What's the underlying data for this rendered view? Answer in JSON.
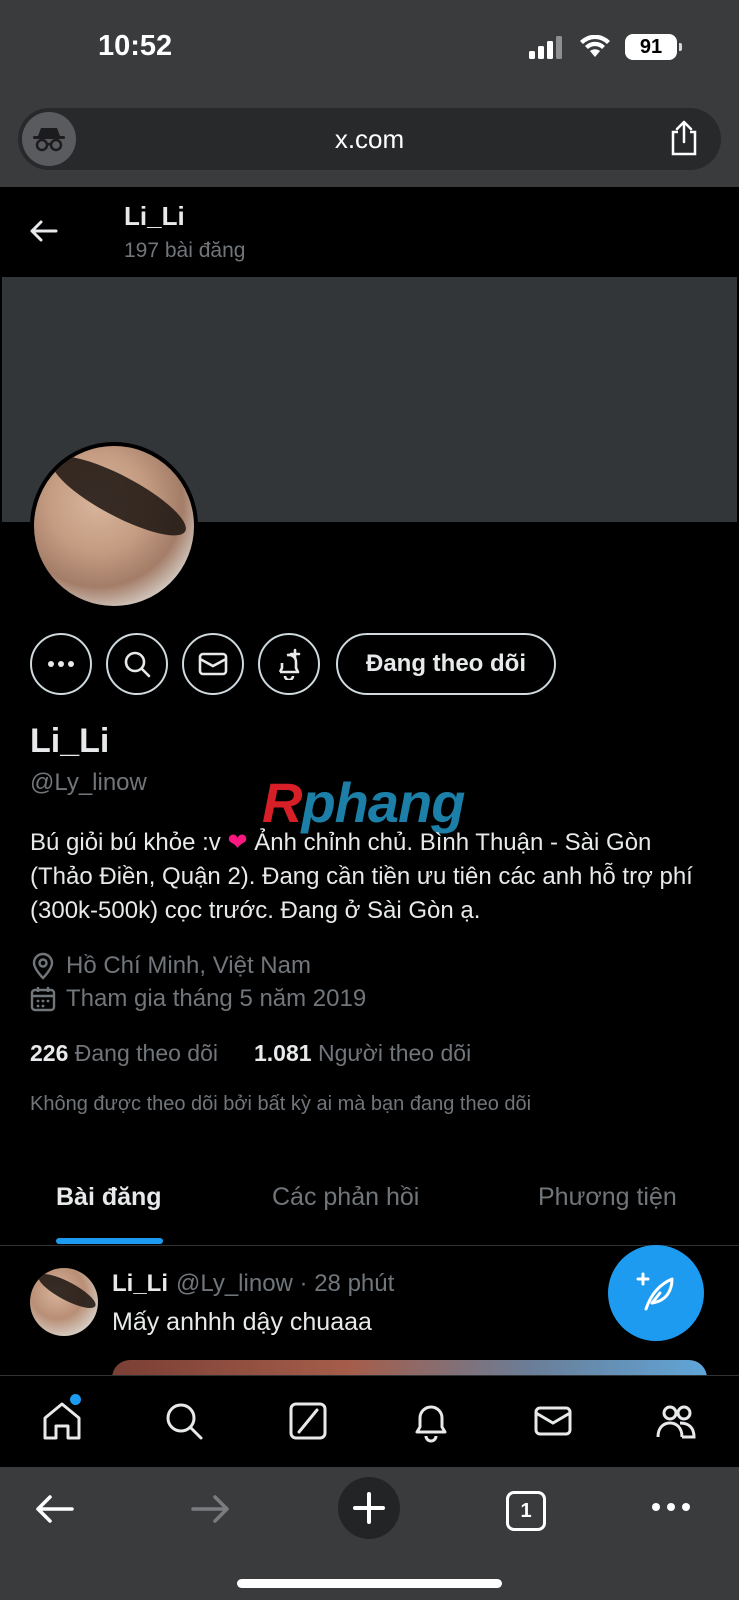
{
  "status": {
    "time": "10:52",
    "battery": "91"
  },
  "browser": {
    "url": "x.com",
    "tab_count": "1"
  },
  "header": {
    "name": "Li_Li",
    "post_count": "197 bài đăng"
  },
  "profile": {
    "name": "Li_Li",
    "handle": "@Ly_linow",
    "follow_button": "Đang theo dõi",
    "bio_before": "Bú giỏi bú khỏe :v ",
    "bio_heart": "❤",
    "bio_after": " Ảnh chỉnh chủ. Bình Thuận - Sài Gòn (Thảo Điền, Quận 2). Đang cần tiền ưu tiên các anh hỗ trợ phí (300k-500k) cọc trước. Đang ở Sài Gòn ạ.",
    "location": "Hồ Chí Minh, Việt Nam",
    "joined": "Tham gia tháng 5 năm 2019",
    "following_count": "226",
    "following_label": "Đang theo dõi",
    "followers_count": "1.081",
    "followers_label": "Người theo dõi",
    "not_followed_note": "Không được theo dõi bởi bất kỳ ai mà bạn đang theo dõi"
  },
  "watermark": {
    "part1": "R",
    "part2": "phang"
  },
  "tabs": [
    {
      "label": "Bài đăng",
      "active": true
    },
    {
      "label": "Các phản hồi",
      "active": false
    },
    {
      "label": "Phương tiện",
      "active": false
    }
  ],
  "post": {
    "name": "Li_Li",
    "meta": "@Ly_linow · 28 phút",
    "text": "Mấy anhhh dậy chuaaa"
  },
  "colors": {
    "accent": "#1d9bf0",
    "background": "#000000",
    "muted": "#71767b",
    "chrome": "#3a3b3d"
  }
}
